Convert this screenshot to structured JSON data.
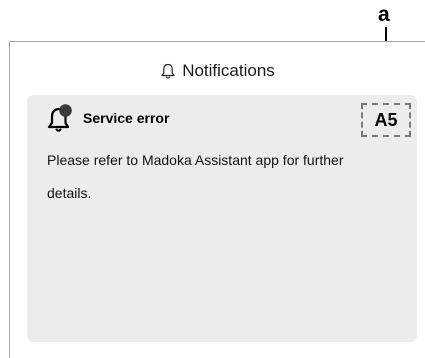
{
  "callout": {
    "label": "a"
  },
  "header": {
    "icon": "bell-icon",
    "title": "Notifications"
  },
  "notification": {
    "icon": "bell-alert-icon",
    "title": "Service error",
    "code": "A5",
    "message": "Please refer to Madoka Assistant app for further details."
  }
}
